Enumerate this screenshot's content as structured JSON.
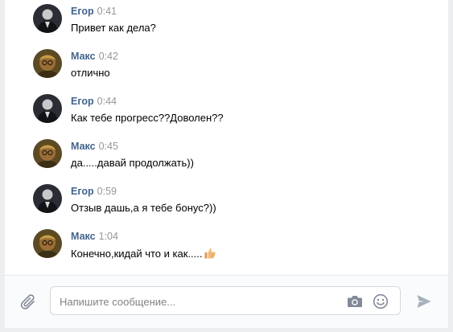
{
  "messages": [
    {
      "author": "Егор",
      "time": "0:41",
      "text": "Привет как дела?",
      "avatar": "egor"
    },
    {
      "author": "Макс",
      "time": "0:42",
      "text": "отлично",
      "avatar": "maks"
    },
    {
      "author": "Егор",
      "time": "0:44",
      "text": "Как тебе прогресс??Доволен??",
      "avatar": "egor"
    },
    {
      "author": "Макс",
      "time": "0:45",
      "text": "да.....давай продолжать))",
      "avatar": "maks"
    },
    {
      "author": "Егор",
      "time": "0:59",
      "text": "Отзыв дашь,а я тебе бонус?))",
      "avatar": "egor"
    },
    {
      "author": "Макс",
      "time": "1:04",
      "text": "Конечно,кидай что и как.....",
      "avatar": "maks",
      "emoji": "thumbs-up-icon"
    }
  ],
  "composer": {
    "placeholder": "Напишите сообщение...",
    "value": "",
    "icons": [
      "paperclip-icon",
      "camera-icon",
      "smile-icon",
      "send-icon"
    ]
  },
  "colors": {
    "author": "#42648b",
    "time": "#939699",
    "background": "#edeef0",
    "icon": "#828a99"
  }
}
